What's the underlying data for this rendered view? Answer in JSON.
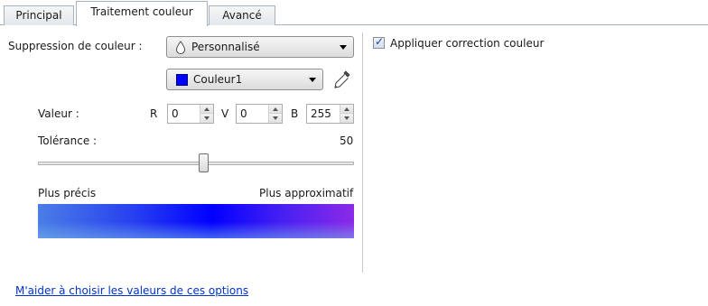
{
  "tabs": [
    {
      "label": "Principal"
    },
    {
      "label": "Traitement couleur"
    },
    {
      "label": "Avancé"
    }
  ],
  "color_suppression": {
    "label": "Suppression de couleur :",
    "selected": "Personnalisé"
  },
  "color_select": {
    "selected": "Couleur1",
    "swatch_color": "#0000ff"
  },
  "value": {
    "label": "Valeur :",
    "r_label": "R",
    "r": "0",
    "v_label": "V",
    "v": "0",
    "b_label": "B",
    "b": "255"
  },
  "tolerance": {
    "label": "Tolérance :",
    "value": "50",
    "slider_fraction": 0.5
  },
  "precision": {
    "left_label": "Plus précis",
    "right_label": "Plus approximatif"
  },
  "apply_correction": {
    "label": "Appliquer correction couleur",
    "checked": true
  },
  "help_link": "M'aider à choisir les valeurs de ces options"
}
